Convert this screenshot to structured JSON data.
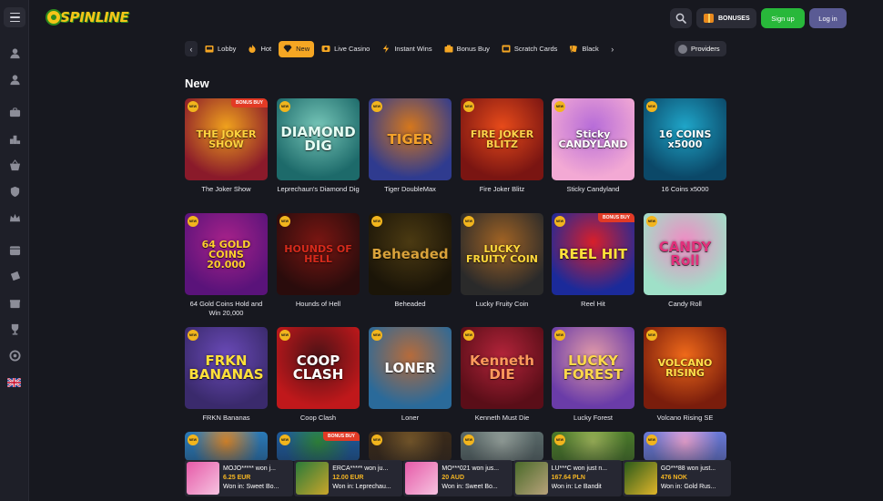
{
  "header": {
    "logo_text": "SPINLINE",
    "bonuses_label": "BONUSES",
    "signup_label": "Sign up",
    "login_label": "Log in"
  },
  "nav": {
    "items": [
      {
        "label": "Lobby",
        "icon": "slot-machine-icon"
      },
      {
        "label": "Hot",
        "icon": "flame-icon"
      },
      {
        "label": "New",
        "icon": "diamond-icon",
        "active": true
      },
      {
        "label": "Live Casino",
        "icon": "live-casino-icon"
      },
      {
        "label": "Instant Wins",
        "icon": "lightning-icon"
      },
      {
        "label": "Bonus Buy",
        "icon": "bonus-buy-icon"
      },
      {
        "label": "Scratch Cards",
        "icon": "scratch-card-icon"
      },
      {
        "label": "Black",
        "icon": "blackjack-icon"
      }
    ],
    "providers_label": "Providers"
  },
  "section_title": "New",
  "games": [
    {
      "title": "The Joker Show",
      "art": "THE JOKER SHOW",
      "bonus": "BONUS BUY",
      "bg": "#8a1a2a",
      "bg2": "#f0a21d",
      "fg": "#ffd23e"
    },
    {
      "title": "Leprechaun's Diamond Dig",
      "art": "DIAMOND DIG",
      "bonus": "",
      "bg": "#1d6a6a",
      "bg2": "#76c6b8",
      "fg": "#e6fff4"
    },
    {
      "title": "Tiger DoubleMax",
      "art": "TIGER",
      "bonus": "",
      "bg": "#2f3b8f",
      "bg2": "#d5771c",
      "fg": "#f3a12a"
    },
    {
      "title": "Fire Joker Blitz",
      "art": "FIRE JOKER BLITZ",
      "bonus": "",
      "bg": "#7a1512",
      "bg2": "#e84b1a",
      "fg": "#ffd24a"
    },
    {
      "title": "Sticky Candyland",
      "art": "Sticky CANDYLAND",
      "bonus": "",
      "bg": "#f3a9d4",
      "bg2": "#b66cd8",
      "fg": "#ffffff"
    },
    {
      "title": "16 Coins x5000",
      "art": "16 COINS x5000",
      "bonus": "",
      "bg": "#0b4868",
      "bg2": "#1fa6c9",
      "fg": "#ffffff"
    },
    {
      "title": "64 Gold Coins Hold and Win 20,000",
      "art": "64 GOLD COINS 20.000",
      "bonus": "",
      "bg": "#5a137a",
      "bg2": "#a8228a",
      "fg": "#ffcf2e"
    },
    {
      "title": "Hounds of Hell",
      "art": "HOUNDS OF HELL",
      "bonus": "",
      "bg": "#2a0c0c",
      "bg2": "#7a1612",
      "fg": "#d62a1b"
    },
    {
      "title": "Beheaded",
      "art": "Beheaded",
      "bonus": "",
      "bg": "#1b1508",
      "bg2": "#4b3a12",
      "fg": "#d9a23a"
    },
    {
      "title": "Lucky Fruity Coin",
      "art": "LUCKY FRUITY COIN",
      "bonus": "",
      "bg": "#2a2a2a",
      "bg2": "#a16324",
      "fg": "#ffd83a"
    },
    {
      "title": "Reel Hit",
      "art": "REEL HIT",
      "bonus": "BONUS BUY",
      "bg": "#1b2a9a",
      "bg2": "#d81f2a",
      "fg": "#ffe13a"
    },
    {
      "title": "Candy Roll",
      "art": "CANDY Roll",
      "bonus": "",
      "bg": "#9fe0c8",
      "bg2": "#f08bc3",
      "fg": "#e2307b"
    },
    {
      "title": "FRKN Bananas",
      "art": "FRKN BANANAS",
      "bonus": "",
      "bg": "#3a2a6c",
      "bg2": "#6a4ab8",
      "fg": "#ffe03a"
    },
    {
      "title": "Coop Clash",
      "art": "COOP CLASH",
      "bonus": "",
      "bg": "#c0181b",
      "bg2": "#4d1216",
      "fg": "#ffffff"
    },
    {
      "title": "Loner",
      "art": "LONER",
      "bonus": "",
      "bg": "#2a6a9a",
      "bg2": "#b66b3b",
      "fg": "#ffffff"
    },
    {
      "title": "Kenneth Must Die",
      "art": "Kenneth DIE",
      "bonus": "",
      "bg": "#5a0e18",
      "bg2": "#b3243a",
      "fg": "#ff9a5c"
    },
    {
      "title": "Lucky Forest",
      "art": "LUCKY FOREST",
      "bonus": "",
      "bg": "#6a3ca8",
      "bg2": "#e19aa8",
      "fg": "#ffd84a"
    },
    {
      "title": "Volcano Rising SE",
      "art": "VOLCANO RISING",
      "bonus": "",
      "bg": "#7a1d0c",
      "bg2": "#f06a1a",
      "fg": "#ffe04a"
    },
    {
      "title": "",
      "art": "",
      "bonus": "",
      "bg": "#2b7ab8",
      "bg2": "#e28b2a",
      "fg": "#ffffff"
    },
    {
      "title": "",
      "art": "",
      "bonus": "BONUS BUY",
      "bg": "#1f5a9a",
      "bg2": "#2f8a3a",
      "fg": "#ffffff"
    },
    {
      "title": "",
      "art": "",
      "bonus": "",
      "bg": "#3a2a1a",
      "bg2": "#7a5a2a",
      "fg": "#ffffff"
    },
    {
      "title": "",
      "art": "",
      "bonus": "",
      "bg": "#5a6a6a",
      "bg2": "#9aa6a0",
      "fg": "#ffffff"
    },
    {
      "title": "",
      "art": "",
      "bonus": "",
      "bg": "#4a7a2a",
      "bg2": "#a0b85a",
      "fg": "#ffffff"
    },
    {
      "title": "",
      "art": "",
      "bonus": "",
      "bg": "#6a7ad8",
      "bg2": "#f2a8d8",
      "fg": "#ffffff"
    }
  ],
  "winners": [
    {
      "user": "MOJO***** won j...",
      "amount": "6.25 EUR",
      "game": "Won in: Sweet Bo...",
      "c1": "#e65aa8",
      "c2": "#f6c3e0"
    },
    {
      "user": "ERCA***** won ju...",
      "amount": "12.00 EUR",
      "game": "Won in: Leprechau...",
      "c1": "#2a7a3a",
      "c2": "#c9a52a"
    },
    {
      "user": "MO***021 won jus...",
      "amount": "20 AUD",
      "game": "Won in: Sweet Bo...",
      "c1": "#e65aa8",
      "c2": "#f6c3e0"
    },
    {
      "user": "LU***C won just n...",
      "amount": "167.64 PLN",
      "game": "Won in: Le Bandit",
      "c1": "#4a6a2a",
      "c2": "#b8a27a"
    },
    {
      "user": "GO***88 won just...",
      "amount": "476 NOK",
      "game": "Won in: Gold Rus...",
      "c1": "#2a5a1a",
      "c2": "#e0b52a"
    }
  ]
}
